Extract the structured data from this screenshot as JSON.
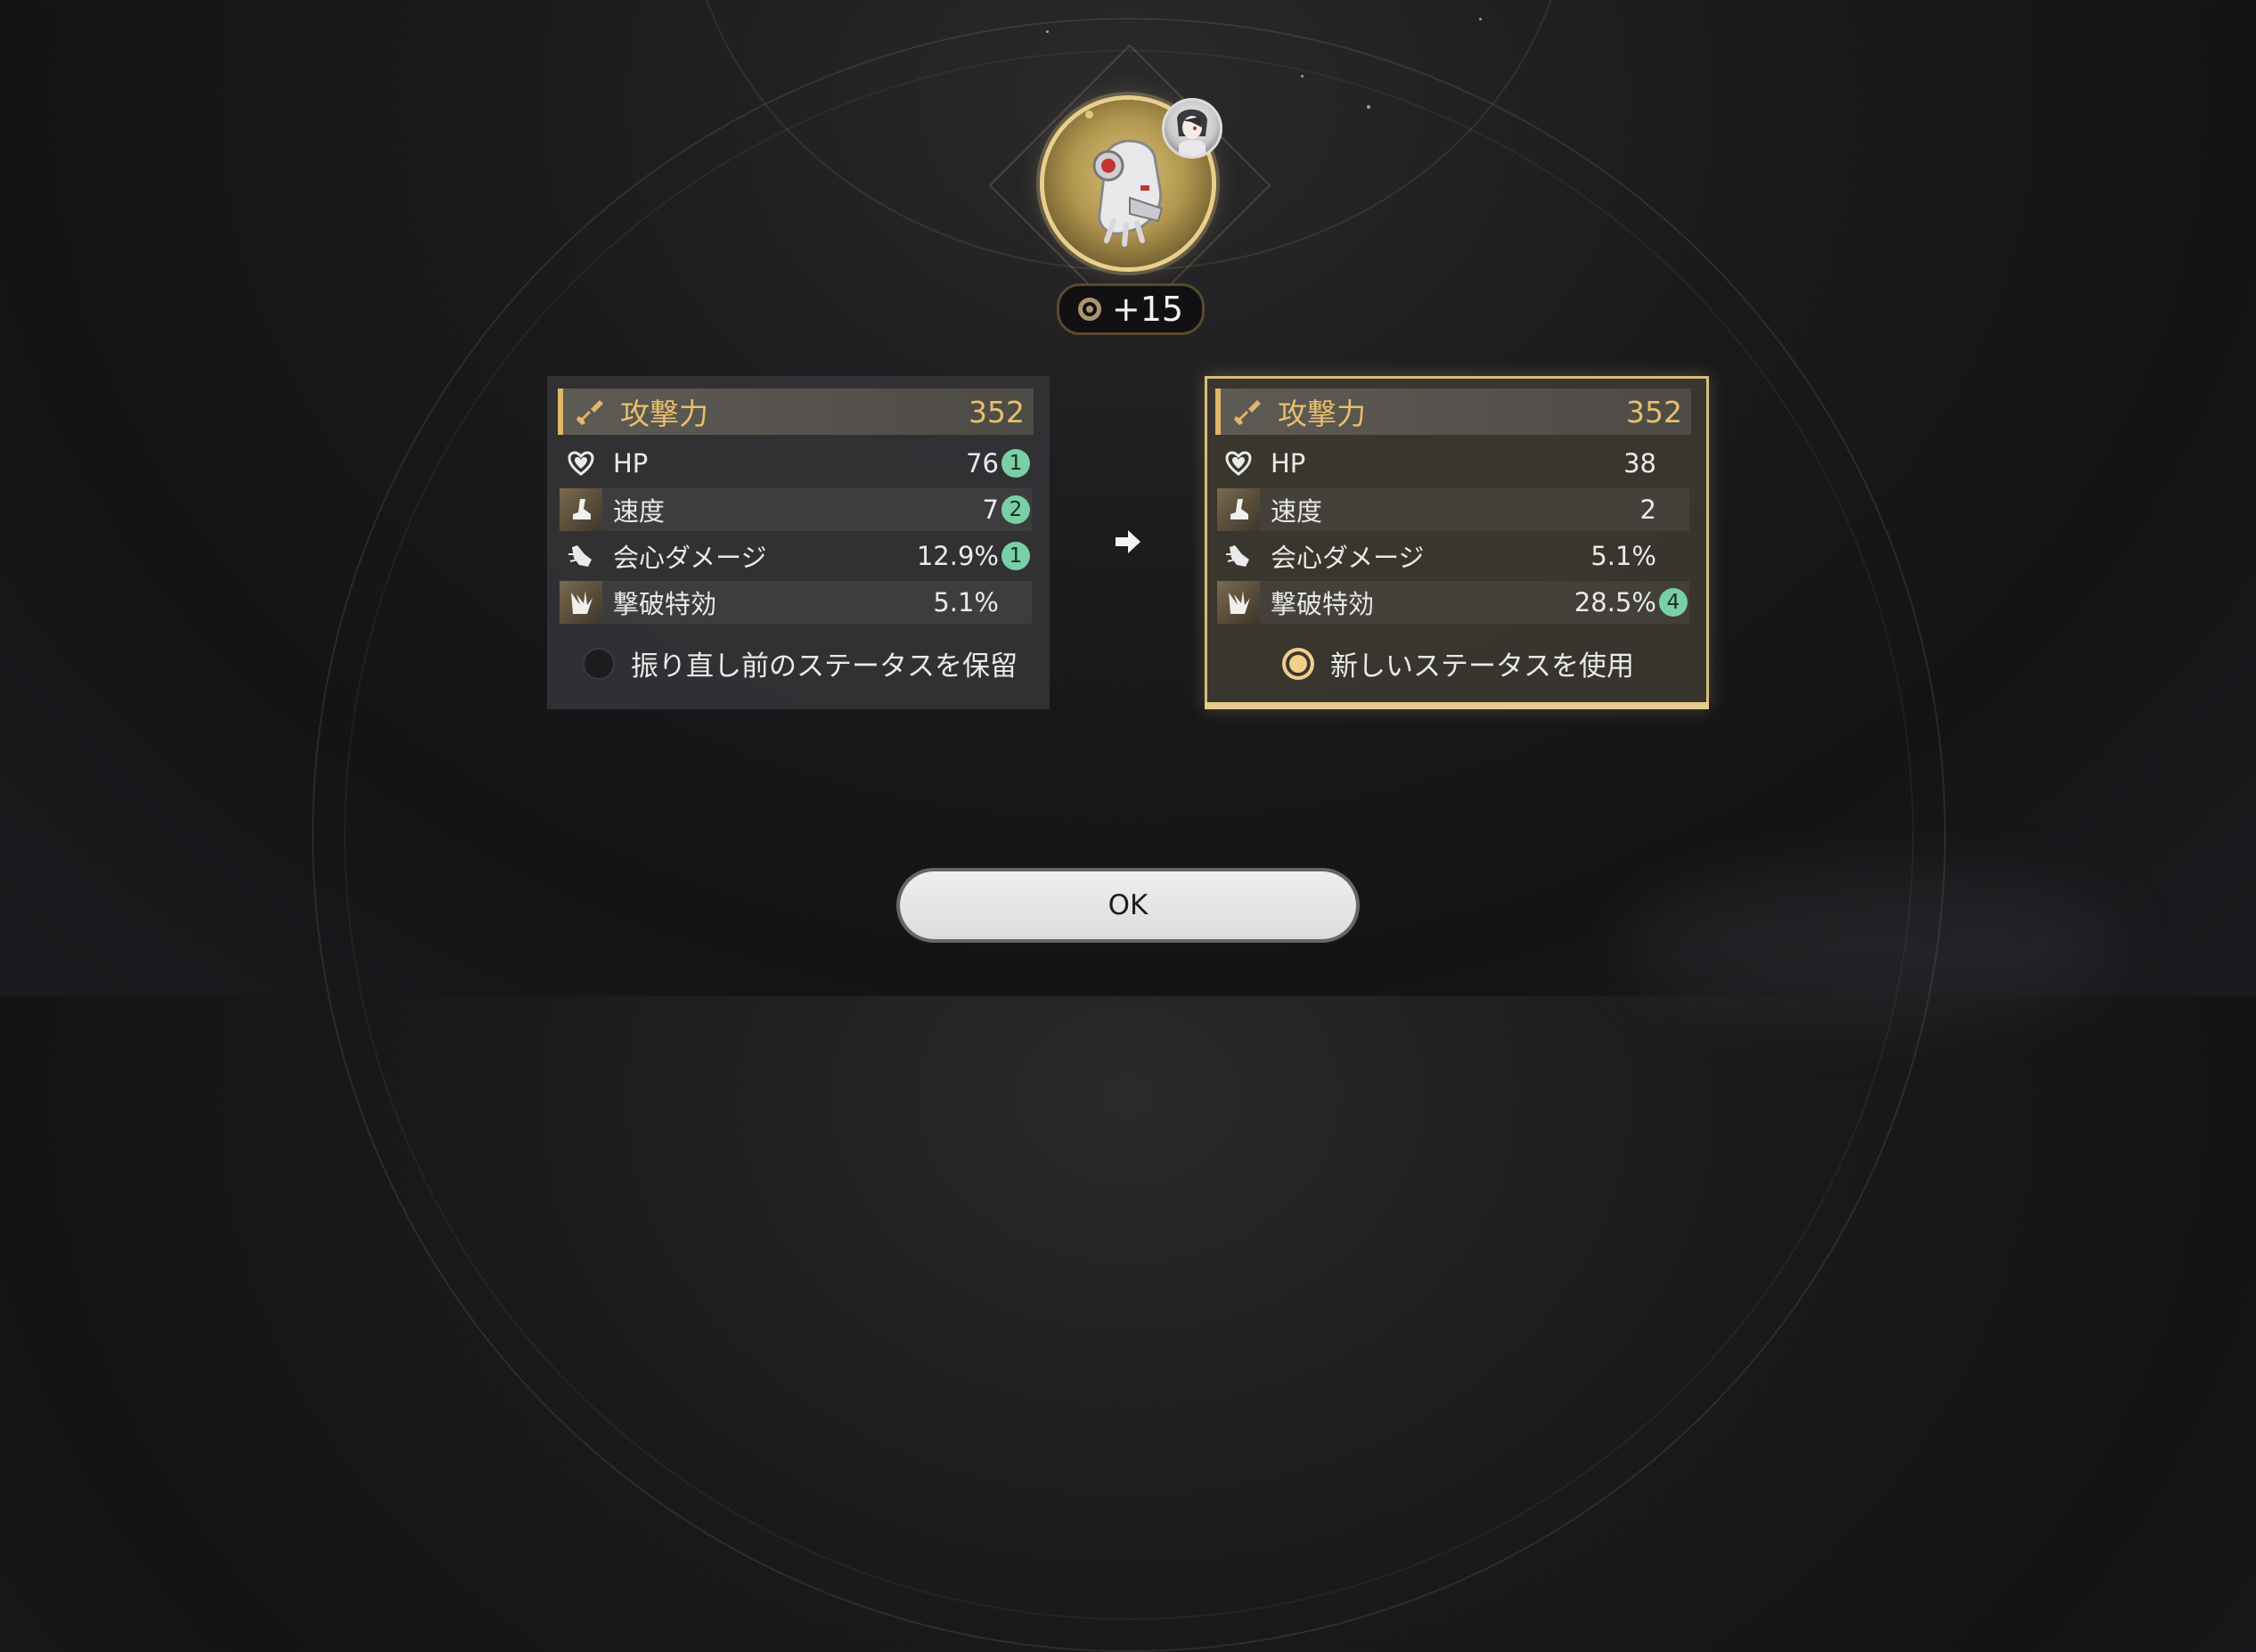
{
  "relic": {
    "level": "+15",
    "level_icon": "relic-level-ring-icon",
    "image_icon": "relic-gloves-icon",
    "owner_icon": "character-avatar-icon"
  },
  "old_stats": {
    "main": {
      "name": "攻撃力",
      "value": "352",
      "icon": "sword-icon"
    },
    "subs": [
      {
        "name": "HP",
        "value": "76",
        "rolls": "1",
        "icon": "heart-icon"
      },
      {
        "name": "速度",
        "value": "7",
        "rolls": "2",
        "icon": "boot-icon"
      },
      {
        "name": "会心ダメージ",
        "value": "12.9%",
        "rolls": "1",
        "icon": "crit-damage-icon"
      },
      {
        "name": "撃破特効",
        "value": "5.1%",
        "rolls": "",
        "icon": "break-effect-icon"
      }
    ],
    "choice_label": "振り直し前のステータスを保留",
    "selected": false
  },
  "new_stats": {
    "main": {
      "name": "攻撃力",
      "value": "352",
      "icon": "sword-icon"
    },
    "subs": [
      {
        "name": "HP",
        "value": "38",
        "rolls": "",
        "icon": "heart-icon"
      },
      {
        "name": "速度",
        "value": "2",
        "rolls": "",
        "icon": "boot-icon"
      },
      {
        "name": "会心ダメージ",
        "value": "5.1%",
        "rolls": "",
        "icon": "crit-damage-icon"
      },
      {
        "name": "撃破特効",
        "value": "28.5%",
        "rolls": "4",
        "icon": "break-effect-icon"
      }
    ],
    "choice_label": "新しいステータスを使用",
    "selected": true
  },
  "ok_label": "OK",
  "colors": {
    "accent_gold": "#e8bf6c",
    "roll_badge": "#79d0a4",
    "selected_border": "#d9bd7e"
  }
}
